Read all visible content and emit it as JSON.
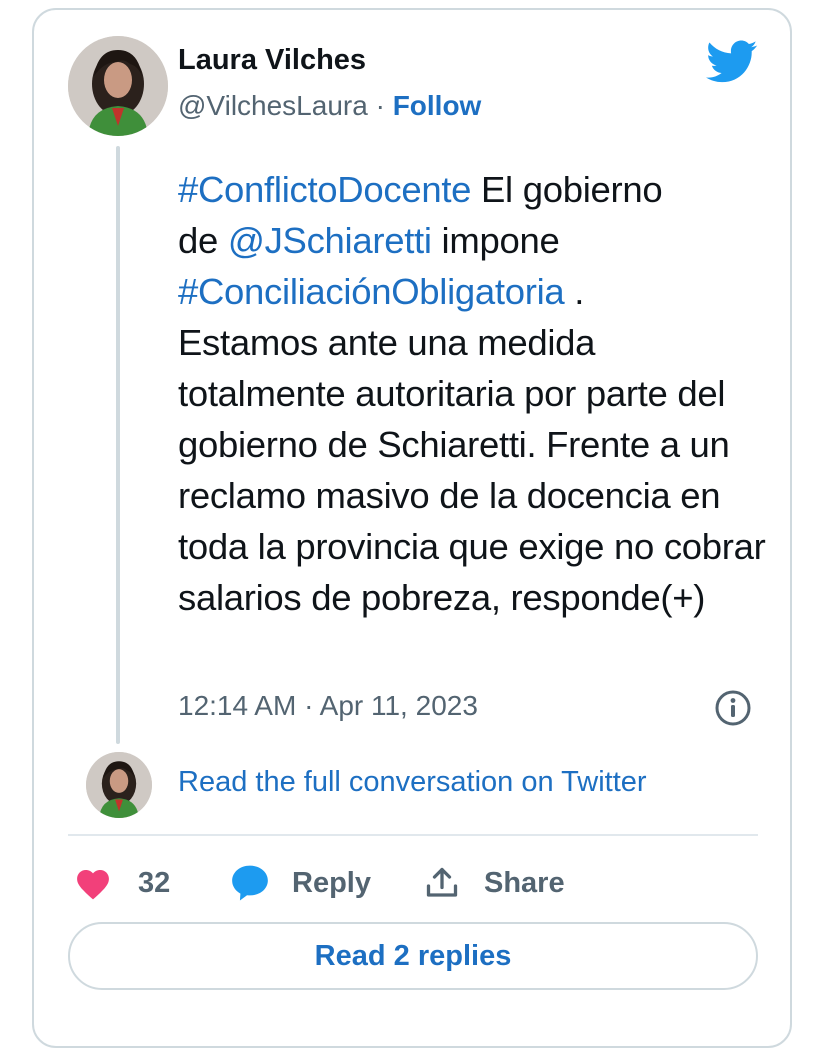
{
  "author": {
    "name": "Laura Vilches",
    "handle": "@VilchesLaura",
    "separator": "·",
    "follow_label": "Follow"
  },
  "tweet": {
    "line1_tag": "#ConflictoDocente",
    "line1_text": " El gobierno",
    "line2_prefix": "de ",
    "line2_mention": "@JSchiaretti",
    "line2_suffix": " impone",
    "line3_tag": "#ConciliaciónObligatoria",
    "line3_suffix": " .",
    "body": "Estamos ante una medida totalmente autoritaria por parte del gobierno de Schiaretti. Frente a un reclamo masivo de la docencia en toda la provincia que exige no cobrar salarios de pobreza, responde(+)",
    "timestamp": "12:14 AM · Apr 11, 2023"
  },
  "conversation_link": "Read the full conversation on Twitter",
  "actions": {
    "like_count": "32",
    "reply_label": "Reply",
    "share_label": "Share"
  },
  "read_replies_label": "Read 2 replies",
  "colors": {
    "link": "#1d6fc2",
    "like": "#f2407a",
    "twitter_blue": "#1d9bf0",
    "muted": "#536471",
    "border": "#cfd9de"
  },
  "icons": [
    "twitter-bird-icon",
    "info-icon",
    "heart-icon",
    "reply-bubble-icon",
    "share-icon"
  ]
}
